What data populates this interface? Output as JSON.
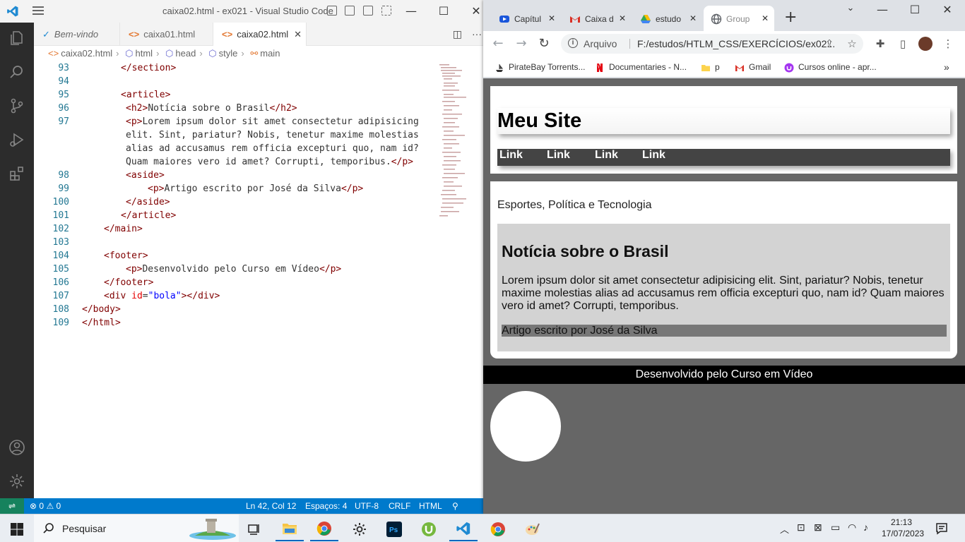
{
  "vscode": {
    "window_title": "caixa02.html - ex021 - Visual Studio Code",
    "tabs": [
      {
        "label": "Bem-vindo"
      },
      {
        "label": "caixa01.html"
      },
      {
        "label": "caixa02.html"
      }
    ],
    "breadcrumbs": [
      "caixa02.html",
      "html",
      "head",
      "style",
      "main"
    ],
    "code_lines": [
      {
        "num": "93"
      },
      {
        "num": "94"
      },
      {
        "num": "95"
      },
      {
        "num": "96"
      },
      {
        "num": "97"
      },
      {
        "num": "98"
      },
      {
        "num": "99"
      },
      {
        "num": "100"
      },
      {
        "num": "101"
      },
      {
        "num": "102"
      },
      {
        "num": "103"
      },
      {
        "num": "104"
      },
      {
        "num": "105"
      },
      {
        "num": "106"
      },
      {
        "num": "107"
      },
      {
        "num": "108"
      },
      {
        "num": "109"
      }
    ],
    "code": {
      "l93": "</section>",
      "l95": "<article>",
      "l96_open": "<h2>",
      "l96_text": "Notícia sobre o Brasil",
      "l96_close": "</h2>",
      "l97_open": "<p>",
      "l97_text_1": "Lorem ipsum dolor sit amet consectetur adipisicing",
      "l97_text_2": "elit. Sint, pariatur? Nobis, tenetur maxime molestias",
      "l97_text_3": "alias ad accusamus rem officia excepturi quo, nam id?",
      "l97_text_4": "Quam maiores vero id amet? Corrupti, temporibus.",
      "l97_close": "</p>",
      "l98": "<aside>",
      "l99_open": "<p>",
      "l99_text": "Artigo escrito por José da Silva",
      "l99_close": "</p>",
      "l100": "</aside>",
      "l101": "</article>",
      "l102": "</main>",
      "l104": "<footer>",
      "l105_open": "<p>",
      "l105_text": "Desenvolvido pelo Curso em Vídeo",
      "l105_close": "</p>",
      "l106": "</footer>",
      "l107_open": "<div",
      "l107_attr": "id",
      "l107_eq": "=",
      "l107_val": "\"bola\"",
      "l107_close": "></div>",
      "l108": "</body>",
      "l109": "</html>"
    },
    "status": {
      "problems": "0",
      "warnings": "0",
      "position": "Ln 42, Col 12",
      "spaces": "Espaços: 4",
      "encoding": "UTF-8",
      "eol": "CRLF",
      "language": "HTML"
    }
  },
  "chrome": {
    "tabs": [
      {
        "label": "Capítul"
      },
      {
        "label": "Caixa d"
      },
      {
        "label": "estudo"
      },
      {
        "label": "Group"
      }
    ],
    "omnibox": {
      "scheme": "Arquivo",
      "url": "F:/estudos/HTLM_CSS/EXERCÍCIOS/ex02..."
    },
    "bookmarks": [
      {
        "label": "PirateBay Torrents..."
      },
      {
        "label": "Documentaries - N..."
      },
      {
        "label": "p"
      },
      {
        "label": "Gmail"
      },
      {
        "label": "Cursos online - apr..."
      }
    ],
    "page": {
      "site_title": "Meu Site",
      "nav_links": [
        "Link",
        "Link",
        "Link",
        "Link"
      ],
      "tagline": "Esportes, Política e Tecnologia",
      "article_title": "Notícia sobre o Brasil",
      "article_body": "Lorem ipsum dolor sit amet consectetur adipisicing elit. Sint, pariatur? Nobis, tenetur maxime molestias alias ad accusamus rem officia excepturi quo, nam id? Quam maiores vero id amet? Corrupti, temporibus.",
      "aside_text": "Artigo escrito por José da Silva",
      "footer_text": "Desenvolvido pelo Curso em Vídeo"
    }
  },
  "taskbar": {
    "search_placeholder": "Pesquisar",
    "time": "21:13",
    "date": "17/07/2023"
  }
}
